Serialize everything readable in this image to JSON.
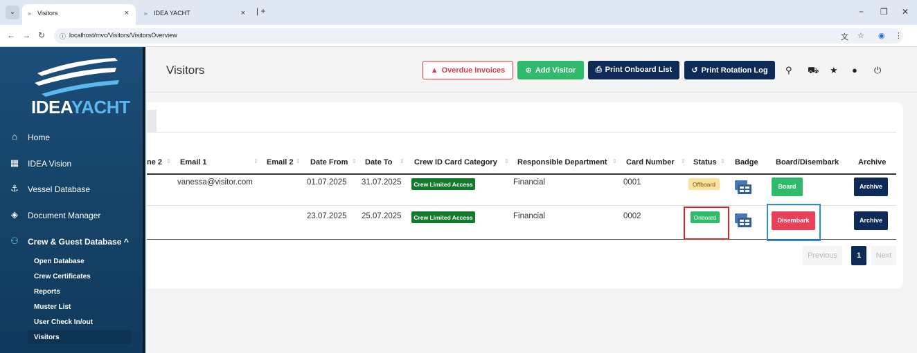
{
  "browser": {
    "tabs": [
      {
        "title": "Visitors",
        "active": true
      },
      {
        "title": "IDEA YACHT",
        "active": false
      }
    ],
    "url": "localhost/mvc/Visitors/VisitorsOverview"
  },
  "sidebar": {
    "logo": {
      "part1": "IDEA",
      "part2": "YACHT"
    },
    "items": [
      {
        "label": "Home",
        "icon": "home-icon"
      },
      {
        "label": "IDEA Vision",
        "icon": "calendar-icon"
      },
      {
        "label": "Vessel Database",
        "icon": "anchor-icon"
      },
      {
        "label": "Document Manager",
        "icon": "layers-icon"
      },
      {
        "label": "Crew & Guest Database ^",
        "icon": "users-icon"
      }
    ],
    "subitems": [
      "Open Database",
      "Crew Certificates",
      "Reports",
      "Muster List",
      "User Check In/out",
      "Visitors"
    ]
  },
  "header": {
    "title": "Visitors",
    "overdue_label": "Overdue Invoices",
    "add_label": "Add Visitor",
    "print_onboard_label": "Print Onboard List",
    "print_rotation_label": "Print Rotation Log"
  },
  "table": {
    "columns": [
      "ne 2",
      "Email 1",
      "Email 2",
      "Date From",
      "Date To",
      "Crew ID Card Category",
      "Responsible Department",
      "Card Number",
      "Status",
      "Badge",
      "Board/Disembark",
      "Archive"
    ],
    "rows": [
      {
        "email1": "vanessa@visitor.com",
        "email2": "",
        "date_from": "01.07.2025",
        "date_to": "31.07.2025",
        "category": "Crew Limited Access",
        "department": "Financial",
        "card": "0001",
        "status": "Offboard",
        "action": "Board",
        "archive": "Archive"
      },
      {
        "email1": "",
        "email2": "",
        "date_from": "23.07.2025",
        "date_to": "25.07.2025",
        "category": "Crew Limited Access",
        "department": "Financial",
        "card": "0002",
        "status": "Onboard",
        "action": "Disembark",
        "archive": "Archive"
      }
    ]
  },
  "pagination": {
    "previous": "Previous",
    "current": "1",
    "next": "Next"
  },
  "colors": {
    "accent": "#0e2a57",
    "success": "#2fbb6b",
    "danger": "#e8415a",
    "warning": "#fbe29e",
    "sidebar": "#154468"
  }
}
